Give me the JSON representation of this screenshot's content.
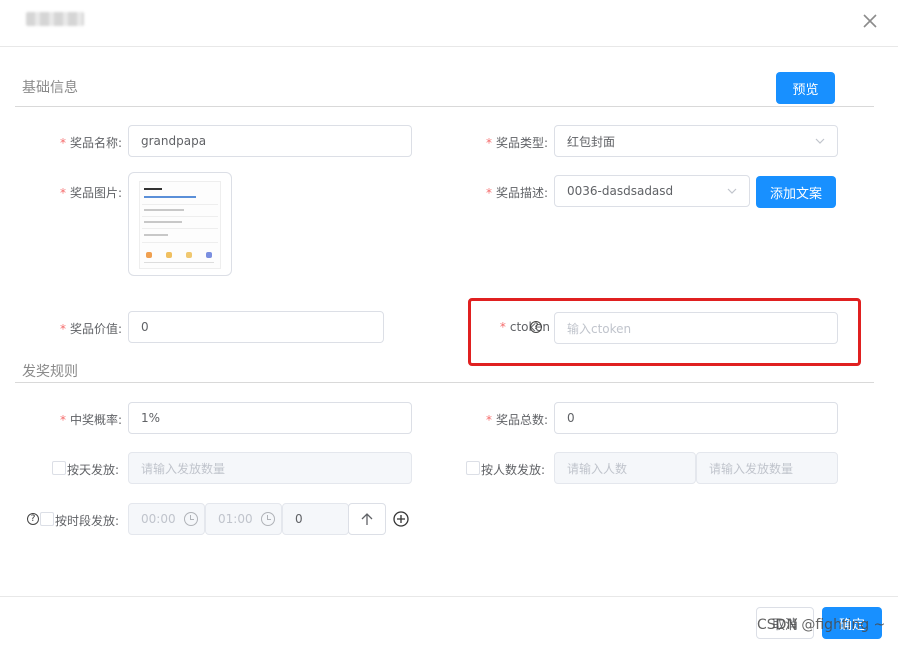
{
  "header": {
    "close_label": "×"
  },
  "sections": {
    "basic": "基础信息",
    "rules": "发奖规则"
  },
  "buttons": {
    "preview": "预览",
    "add_copy": "添加文案",
    "cancel": "取消",
    "confirm": "确定",
    "add_time": "↑"
  },
  "form": {
    "prize_name": {
      "label": "奖品名称:",
      "value": "grandpapa"
    },
    "prize_type": {
      "label": "奖品类型:",
      "value": "红包封面"
    },
    "prize_image": {
      "label": "奖品图片:"
    },
    "prize_desc": {
      "label": "奖品描述:",
      "value": "0036-dasdsadasd"
    },
    "prize_value": {
      "label": "奖品价值:",
      "value": "0"
    },
    "ctoken": {
      "label": "ctoken",
      "colon": ":",
      "placeholder": "输入ctoken"
    },
    "win_rate": {
      "label": "中奖概率:",
      "value": "1%"
    },
    "total_count": {
      "label": "奖品总数:",
      "value": "0"
    },
    "by_day": {
      "label": "按天发放:",
      "placeholder": "请输入发放数量"
    },
    "by_people": {
      "label": "按人数发放:",
      "placeholder_people": "请输入人数",
      "placeholder_count": "请输入发放数量"
    },
    "by_period": {
      "label": "按时段发放:",
      "start": "00:00",
      "end": "01:00",
      "count": "0"
    }
  },
  "watermark": "CSDN @fighting ~",
  "colors": {
    "primary": "#1890ff",
    "required": "#f56c6c",
    "highlight": "#e02020"
  }
}
